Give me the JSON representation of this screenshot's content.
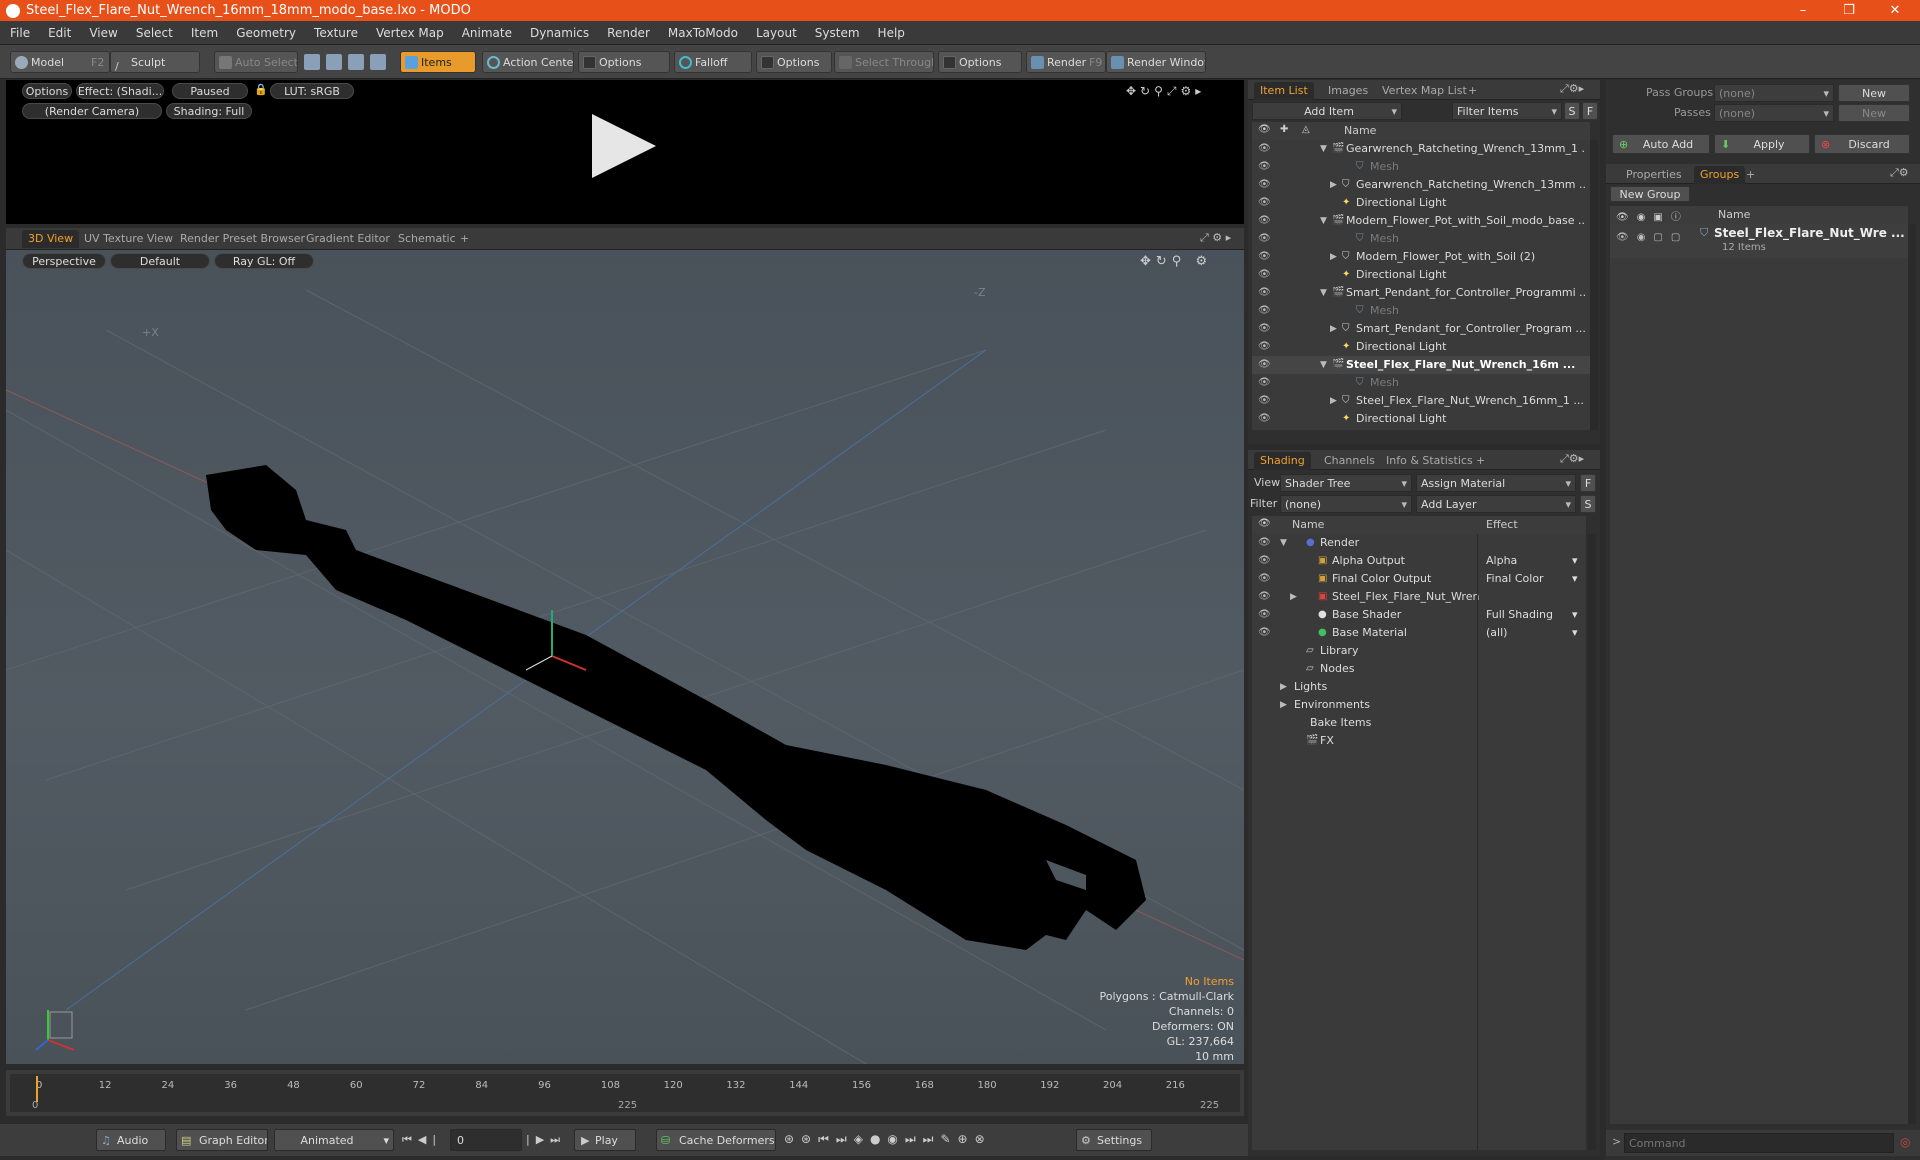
{
  "window": {
    "title": "Steel_Flex_Flare_Nut_Wrench_16mm_18mm_modo_base.lxo - MODO",
    "min": "–",
    "max": "❐",
    "close": "✕"
  },
  "menu": [
    "File",
    "Edit",
    "View",
    "Select",
    "Item",
    "Geometry",
    "Texture",
    "Vertex Map",
    "Animate",
    "Dynamics",
    "Render",
    "MaxToModo",
    "Layout",
    "System",
    "Help"
  ],
  "toolbar": {
    "model": "Model",
    "model_key": "F2",
    "sculpt": "Sculpt",
    "auto_select": "Auto Select",
    "items": "Items",
    "action_center": "Action Center",
    "options1": "Options",
    "falloff": "Falloff",
    "options2": "Options",
    "select_through": "Select Through",
    "options3": "Options",
    "render": "Render",
    "render_key": "F9",
    "render_window": "Render Window"
  },
  "preview": {
    "options": "Options",
    "effect": "Effect: (Shadi...",
    "paused": "Paused",
    "lut": "LUT: sRGB",
    "camera": "(Render Camera)",
    "shading": "Shading: Full"
  },
  "viewport_tabs": [
    "3D View",
    "UV Texture View",
    "Render Preset Browser",
    "Gradient Editor",
    "Schematic",
    "+"
  ],
  "viewport": {
    "perspective": "Perspective",
    "default": "Default",
    "raygl": "Ray GL: Off",
    "axis_x": "+X",
    "axis_z": "-Z",
    "info": [
      "No Items",
      "Polygons : Catmull-Clark",
      "Channels: 0",
      "Deformers: ON",
      "GL: 237,664",
      "10 mm"
    ]
  },
  "timeline": {
    "ticks": [
      "0",
      "12",
      "24",
      "36",
      "48",
      "60",
      "72",
      "84",
      "96",
      "108",
      "120",
      "132",
      "144",
      "156",
      "168",
      "180",
      "192",
      "204",
      "216"
    ],
    "sub": [
      "0",
      "225",
      "225"
    ]
  },
  "bottom": {
    "audio": "Audio",
    "graph_editor": "Graph Editor",
    "animated": "Animated",
    "frame": "0",
    "play": "Play",
    "cache": "Cache Deformers",
    "settings": "Settings"
  },
  "item_list": {
    "tabs": [
      "Item List",
      "Images",
      "Vertex Map List",
      "+"
    ],
    "add_item": "Add Item",
    "filter": "Filter Items",
    "s": "S",
    "f": "F",
    "col_name": "Name",
    "rows": [
      {
        "label": "Gearwrench_Ratcheting_Wrench_13mm_1 ...",
        "indent": 0,
        "kind": "scene",
        "bold": false
      },
      {
        "label": "Mesh",
        "indent": 2,
        "kind": "mesh",
        "bold": false
      },
      {
        "label": "Gearwrench_Ratcheting_Wrench_13mm ...",
        "indent": 1,
        "kind": "group",
        "bold": false
      },
      {
        "label": "Directional Light",
        "indent": 1,
        "kind": "light",
        "bold": false
      },
      {
        "label": "Modern_Flower_Pot_with_Soil_modo_base ...",
        "indent": 0,
        "kind": "scene",
        "bold": false
      },
      {
        "label": "Mesh",
        "indent": 2,
        "kind": "mesh",
        "bold": false
      },
      {
        "label": "Modern_Flower_Pot_with_Soil (2)",
        "indent": 1,
        "kind": "group",
        "bold": false
      },
      {
        "label": "Directional Light",
        "indent": 1,
        "kind": "light",
        "bold": false
      },
      {
        "label": "Smart_Pendant_for_Controller_Programmi ...",
        "indent": 0,
        "kind": "scene",
        "bold": false
      },
      {
        "label": "Mesh",
        "indent": 2,
        "kind": "mesh",
        "bold": false
      },
      {
        "label": "Smart_Pendant_for_Controller_Program ...",
        "indent": 1,
        "kind": "group",
        "bold": false
      },
      {
        "label": "Directional Light",
        "indent": 1,
        "kind": "light",
        "bold": false
      },
      {
        "label": "Steel_Flex_Flare_Nut_Wrench_16m ...",
        "indent": 0,
        "kind": "scene",
        "bold": true
      },
      {
        "label": "Mesh",
        "indent": 2,
        "kind": "mesh",
        "bold": false
      },
      {
        "label": "Steel_Flex_Flare_Nut_Wrench_16mm_1 ...",
        "indent": 1,
        "kind": "group",
        "bold": false
      },
      {
        "label": "Directional Light",
        "indent": 1,
        "kind": "light",
        "bold": false
      }
    ]
  },
  "shading": {
    "tabs": [
      "Shading",
      "Channels",
      "Info & Statistics",
      "+"
    ],
    "view_label": "View",
    "view_value": "Shader Tree",
    "assign": "Assign Material",
    "f": "F",
    "filter_label": "Filter",
    "filter_value": "(none)",
    "add_layer": "Add Layer",
    "s": "S",
    "col_name": "Name",
    "col_effect": "Effect",
    "rows": [
      {
        "label": "Render",
        "effect": "",
        "indent": 0
      },
      {
        "label": "Alpha Output",
        "effect": "Alpha",
        "indent": 1
      },
      {
        "label": "Final Color Output",
        "effect": "Final Color",
        "indent": 1
      },
      {
        "label": "Steel_Flex_Flare_Nut_Wren ...",
        "effect": "",
        "indent": 1
      },
      {
        "label": "Base Shader",
        "effect": "Full Shading",
        "indent": 1
      },
      {
        "label": "Base Material",
        "effect": "(all)",
        "indent": 1
      },
      {
        "label": "Library",
        "effect": "",
        "indent": 0
      },
      {
        "label": "Nodes",
        "effect": "",
        "indent": 0
      },
      {
        "label": "Lights",
        "effect": "",
        "indent": -1
      },
      {
        "label": "Environments",
        "effect": "",
        "indent": -1
      },
      {
        "label": "Bake Items",
        "effect": "",
        "indent": -1
      },
      {
        "label": "FX",
        "effect": "",
        "indent": 0
      }
    ]
  },
  "groups": {
    "pass_groups": "Pass Groups",
    "pass_groups_val": "(none)",
    "new": "New",
    "passes": "Passes",
    "passes_val": "(none)",
    "new2": "New",
    "auto_add": "Auto Add",
    "apply": "Apply",
    "discard": "Discard",
    "tabs": [
      "Properties",
      "Groups",
      "+"
    ],
    "new_group": "New Group",
    "col_name": "Name",
    "item_name": "Steel_Flex_Flare_Nut_Wre ...",
    "item_count": "12 Items"
  },
  "command": {
    "placeholder": "Command"
  }
}
